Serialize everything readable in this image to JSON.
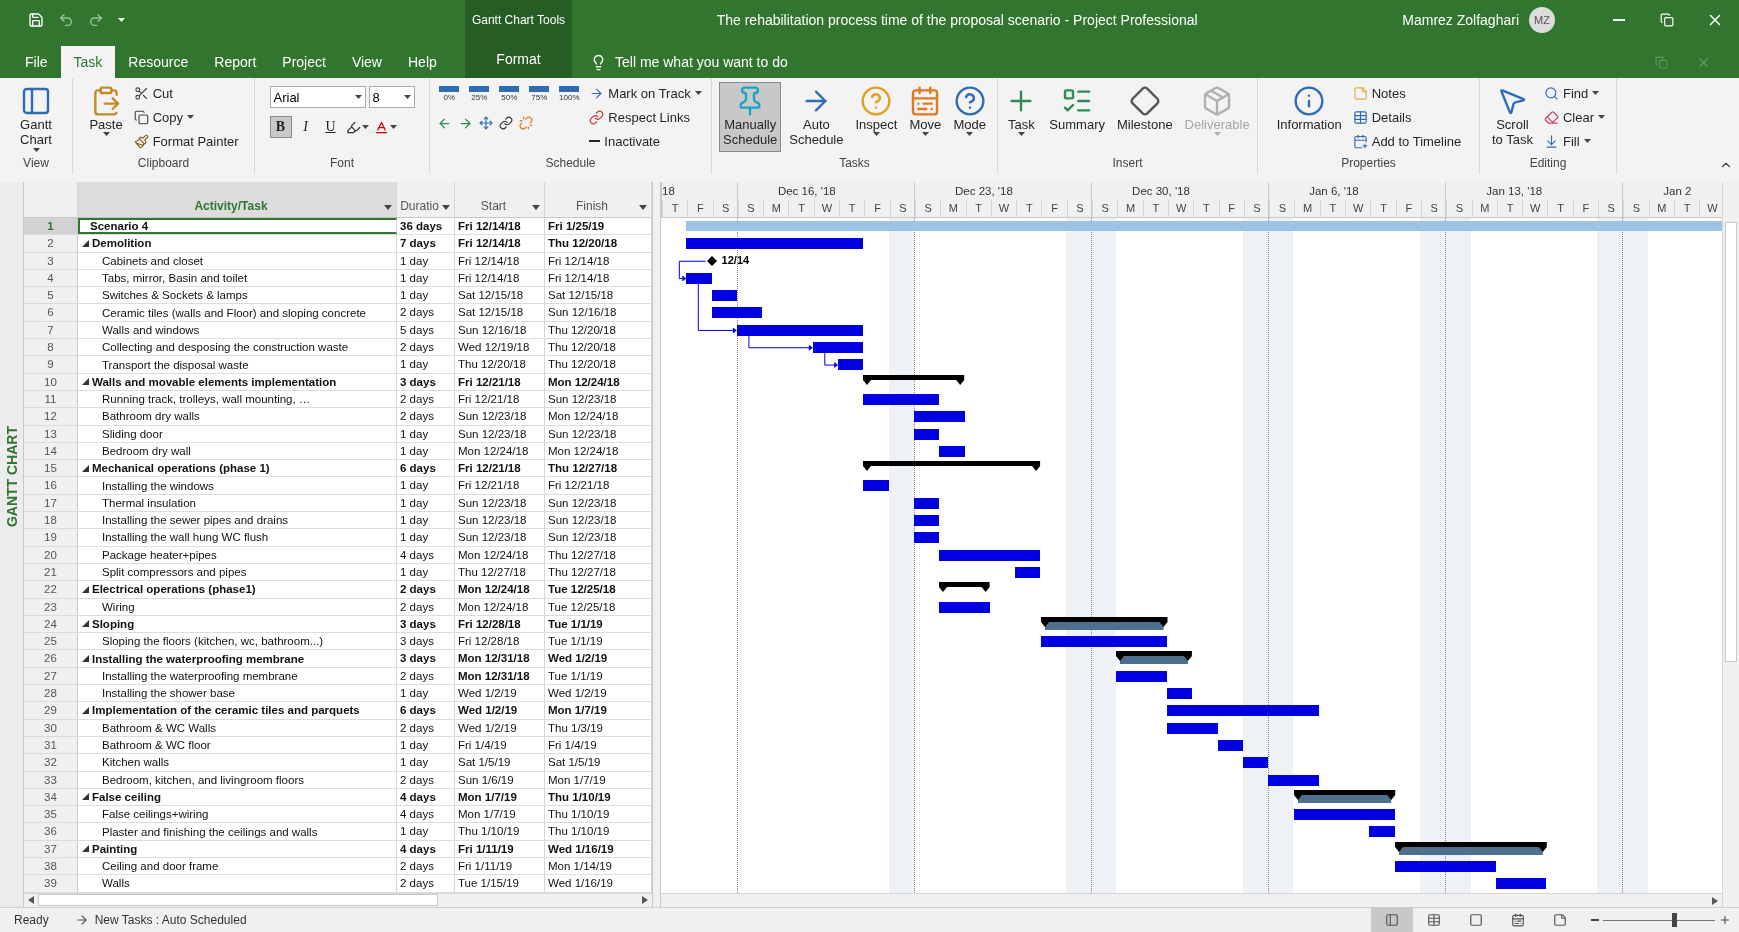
{
  "window": {
    "title": "The rehabilitation process time of the proposal scenario  -  Project Professional",
    "context_title": "Gantt Chart Tools",
    "user": "Mamrez Zolfaghari",
    "avatar": "MZ"
  },
  "tabs": [
    {
      "label": "File",
      "selected": false,
      "contextual": false
    },
    {
      "label": "Task",
      "selected": true,
      "contextual": false
    },
    {
      "label": "Resource",
      "selected": false,
      "contextual": false
    },
    {
      "label": "Report",
      "selected": false,
      "contextual": false
    },
    {
      "label": "Project",
      "selected": false,
      "contextual": false
    },
    {
      "label": "View",
      "selected": false,
      "contextual": false
    },
    {
      "label": "Help",
      "selected": false,
      "contextual": false
    },
    {
      "label": "Format",
      "selected": false,
      "contextual": true
    }
  ],
  "tell_me": {
    "placeholder": "Tell me what you want to do"
  },
  "ribbon": [
    {
      "label": "View",
      "controls": [
        {
          "kind": "large",
          "label": "Gantt\nChart",
          "dropdown": true
        }
      ]
    },
    {
      "label": "Clipboard",
      "controls": [
        {
          "kind": "large",
          "label": "Paste",
          "dropdown": true
        },
        {
          "kind": "small",
          "label": "Cut"
        },
        {
          "kind": "small",
          "label": "Copy",
          "dropdown": true
        },
        {
          "kind": "small",
          "label": "Format Painter"
        }
      ]
    },
    {
      "label": "Font",
      "controls": [
        {
          "kind": "font",
          "font": "Arial",
          "size": "8",
          "styles": [
            {
              "label": "B",
              "on": true
            },
            {
              "label": "I",
              "on": false
            },
            {
              "label": "U",
              "on": false
            }
          ]
        }
      ]
    },
    {
      "label": "Schedule",
      "controls": [
        {
          "kind": "percent",
          "items": [
            "0%",
            "25%",
            "50%",
            "75%",
            "100%"
          ]
        },
        {
          "kind": "small",
          "label": "Mark on Track",
          "dropdown": true
        },
        {
          "kind": "small",
          "label": "Respect Links"
        },
        {
          "kind": "small",
          "label": "Inactivate"
        }
      ]
    },
    {
      "label": "Tasks",
      "controls": [
        {
          "kind": "large",
          "label": "Manually\nSchedule",
          "selected": true
        },
        {
          "kind": "large",
          "label": "Auto\nSchedule",
          "selected": false
        },
        {
          "kind": "large",
          "label": "Inspect",
          "dropdown": true
        },
        {
          "kind": "large",
          "label": "Move",
          "dropdown": true
        },
        {
          "kind": "large",
          "label": "Mode",
          "dropdown": true
        }
      ]
    },
    {
      "label": "Insert",
      "controls": [
        {
          "kind": "large",
          "label": "Task",
          "dropdown": true
        },
        {
          "kind": "large",
          "label": "Summary"
        },
        {
          "kind": "large",
          "label": "Milestone"
        },
        {
          "kind": "large",
          "label": "Deliverable",
          "dropdown": true,
          "disabled": true
        }
      ]
    },
    {
      "label": "Properties",
      "controls": [
        {
          "kind": "large",
          "label": "Information"
        },
        {
          "kind": "small",
          "label": "Notes"
        },
        {
          "kind": "small",
          "label": "Details"
        },
        {
          "kind": "small",
          "label": "Add to Timeline"
        }
      ]
    },
    {
      "label": "Editing",
      "controls": [
        {
          "kind": "large",
          "label": "Scroll\nto Task"
        },
        {
          "kind": "small",
          "label": "Find",
          "dropdown": true
        },
        {
          "kind": "small",
          "label": "Clear",
          "dropdown": true
        },
        {
          "kind": "small",
          "label": "Fill",
          "dropdown": true
        }
      ]
    }
  ],
  "side_label": "GANTT CHART",
  "table": {
    "columns": [
      "Activity/Task",
      "Duratio",
      "Start",
      "Finish"
    ],
    "rows": [
      {
        "id": "1",
        "name": "Scenario 4",
        "duration": "36 days",
        "start": "Fri 12/14/18",
        "finish": "Fri 1/25/19",
        "bold": true,
        "kind": "project",
        "selected": true
      },
      {
        "id": "2",
        "name": "Demolition",
        "duration": "7 days",
        "start": "Fri 12/14/18",
        "finish": "Thu 12/20/18",
        "bold": true,
        "kind": "task",
        "selected": false,
        "expanded": true,
        "children": [
          {
            "id": "3",
            "name": "Cabinets and closet",
            "duration": "1 day",
            "start": "Fri 12/14/18",
            "finish": "Fri 12/14/18",
            "kind": "milestone",
            "milestone_label": "12/14",
            "selected": false
          },
          {
            "id": "4",
            "name": "Tabs, mirror, Basin and toilet",
            "duration": "1 day",
            "start": "Fri 12/14/18",
            "finish": "Fri 12/14/18",
            "kind": "task",
            "linked": true,
            "selected": false
          },
          {
            "id": "5",
            "name": "Switches & Sockets & lamps",
            "duration": "1 day",
            "start": "Sat 12/15/18",
            "finish": "Sat 12/15/18",
            "kind": "task",
            "selected": false
          },
          {
            "id": "6",
            "name": "Ceramic tiles (walls and Floor) and sloping concrete",
            "duration": "2 days",
            "start": "Sat 12/15/18",
            "finish": "Sun 12/16/18",
            "kind": "task",
            "selected": false
          },
          {
            "id": "7",
            "name": "Walls and windows",
            "duration": "5 days",
            "start": "Sun 12/16/18",
            "finish": "Thu 12/20/18",
            "kind": "task",
            "linked": true,
            "selected": false
          },
          {
            "id": "8",
            "name": "Collecting and desposing the construction waste",
            "duration": "2 days",
            "start": "Wed 12/19/18",
            "finish": "Thu 12/20/18",
            "kind": "task",
            "linked": true,
            "selected": false
          },
          {
            "id": "9",
            "name": "Transport the disposal waste",
            "duration": "1 day",
            "start": "Thu 12/20/18",
            "finish": "Thu 12/20/18",
            "kind": "task",
            "linked": true,
            "selected": false
          }
        ]
      },
      {
        "id": "10",
        "name": "Walls and movable elements implementation",
        "duration": "3 days",
        "start": "Fri 12/21/18",
        "finish": "Mon 12/24/18",
        "bold": true,
        "kind": "summary",
        "selected": false,
        "expanded": true,
        "children": [
          {
            "id": "11",
            "name": "Running track, trolleys, wall mounting, …",
            "duration": "2 days",
            "start": "Fri 12/21/18",
            "finish": "Sun 12/23/18",
            "kind": "task",
            "selected": false
          },
          {
            "id": "12",
            "name": "Bathroom dry walls",
            "duration": "2 days",
            "start": "Sun 12/23/18",
            "finish": "Mon 12/24/18",
            "kind": "task",
            "selected": false
          },
          {
            "id": "13",
            "name": "Sliding door",
            "duration": "1 day",
            "start": "Sun 12/23/18",
            "finish": "Sun 12/23/18",
            "kind": "task",
            "selected": false
          },
          {
            "id": "14",
            "name": "Bedroom dry wall",
            "duration": "1 day",
            "start": "Mon 12/24/18",
            "finish": "Mon 12/24/18",
            "kind": "task",
            "selected": false
          }
        ]
      },
      {
        "id": "15",
        "name": "Mechanical operations (phase 1)",
        "duration": "6 days",
        "start": "Fri 12/21/18",
        "finish": "Thu 12/27/18",
        "bold": true,
        "kind": "summary",
        "selected": false,
        "expanded": true,
        "children": [
          {
            "id": "16",
            "name": "Installing the windows",
            "duration": "1 day",
            "start": "Fri 12/21/18",
            "finish": "Fri 12/21/18",
            "kind": "task",
            "selected": false
          },
          {
            "id": "17",
            "name": "Thermal insulation",
            "duration": "1 day",
            "start": "Sun 12/23/18",
            "finish": "Sun 12/23/18",
            "kind": "task",
            "selected": false
          },
          {
            "id": "18",
            "name": "Installing the sewer pipes and drains",
            "duration": "1 day",
            "start": "Sun 12/23/18",
            "finish": "Sun 12/23/18",
            "kind": "task",
            "selected": false
          },
          {
            "id": "19",
            "name": "Installing the wall hung WC flush",
            "duration": "1 day",
            "start": "Sun 12/23/18",
            "finish": "Sun 12/23/18",
            "kind": "task",
            "selected": false
          },
          {
            "id": "20",
            "name": "Package heater+pipes",
            "duration": "4 days",
            "start": "Mon 12/24/18",
            "finish": "Thu 12/27/18",
            "kind": "task",
            "selected": false
          },
          {
            "id": "21",
            "name": "Split compressors and pipes",
            "duration": "1 day",
            "start": "Thu 12/27/18",
            "finish": "Thu 12/27/18",
            "kind": "task",
            "selected": false
          }
        ]
      },
      {
        "id": "22",
        "name": "Electrical operations (phase1)",
        "duration": "2 days",
        "start": "Mon 12/24/18",
        "finish": "Tue 12/25/18",
        "bold": true,
        "kind": "summary",
        "selected": false,
        "expanded": true,
        "children": [
          {
            "id": "23",
            "name": "Wiring",
            "duration": "2 days",
            "start": "Mon 12/24/18",
            "finish": "Tue 12/25/18",
            "kind": "task",
            "selected": false
          }
        ]
      },
      {
        "id": "24",
        "name": "Sloping",
        "duration": "3 days",
        "start": "Fri 12/28/18",
        "finish": "Tue 1/1/19",
        "bold": true,
        "kind": "rollup",
        "selected": false,
        "expanded": true,
        "children": [
          {
            "id": "25",
            "name": "Sloping the floors (kitchen, wc, bathroom...)",
            "duration": "3 days",
            "start": "Fri 12/28/18",
            "finish": "Tue 1/1/19",
            "kind": "task",
            "selected": false
          }
        ]
      },
      {
        "id": "26",
        "name": "Installing the waterproofing membrane",
        "duration": "3 days",
        "start": "Mon 12/31/18",
        "finish": "Wed 1/2/19",
        "bold": true,
        "kind": "rollup",
        "selected": false,
        "expanded": true,
        "children": [
          {
            "id": "27",
            "name": "Installing the waterproofing membrane",
            "duration": "2 days",
            "start": "**Mon 12/31/18**",
            "finish": "Tue 1/1/19",
            "kind": "task",
            "selected": false
          },
          {
            "id": "28",
            "name": "Installing the shower base",
            "duration": "1 day",
            "start": "Wed 1/2/19",
            "finish": "Wed 1/2/19",
            "kind": "task",
            "selected": false
          }
        ]
      },
      {
        "id": "29",
        "name": "Implementation of the ceramic tiles and parquets",
        "duration": "6 days",
        "start": "Wed 1/2/19",
        "finish": "Mon 1/7/19",
        "bold": true,
        "kind": "task",
        "selected": false,
        "expanded": true,
        "children": [
          {
            "id": "30",
            "name": "Bathroom & WC Walls",
            "duration": "2 days",
            "start": "Wed 1/2/19",
            "finish": "Thu 1/3/19",
            "kind": "task",
            "selected": false
          },
          {
            "id": "31",
            "name": "Bathroom & WC floor",
            "duration": "1 day",
            "start": "Fri 1/4/19",
            "finish": "Fri 1/4/19",
            "kind": "task",
            "selected": false
          },
          {
            "id": "32",
            "name": "Kitchen walls",
            "duration": "1 day",
            "start": "Sat 1/5/19",
            "finish": "Sat 1/5/19",
            "kind": "task",
            "selected": false
          },
          {
            "id": "33",
            "name": "Bedroom, kitchen, and livingroom floors",
            "duration": "2 days",
            "start": "Sun 1/6/19",
            "finish": "Mon 1/7/19",
            "kind": "task",
            "selected": false
          }
        ]
      },
      {
        "id": "34",
        "name": "False ceiling",
        "duration": "4 days",
        "start": "Mon 1/7/19",
        "finish": "Thu 1/10/19",
        "bold": true,
        "kind": "rollup",
        "selected": false,
        "expanded": true,
        "children": [
          {
            "id": "35",
            "name": "False ceilings+wiring",
            "duration": "4 days",
            "start": "Mon 1/7/19",
            "finish": "Thu 1/10/19",
            "kind": "task",
            "selected": false
          },
          {
            "id": "36",
            "name": "Plaster and finishing the ceilings and walls",
            "duration": "1 day",
            "start": "Thu 1/10/19",
            "finish": "Thu 1/10/19",
            "kind": "task",
            "selected": false
          }
        ]
      },
      {
        "id": "37",
        "name": "Painting",
        "duration": "4 days",
        "start": "Fri 1/11/19",
        "finish": "Wed 1/16/19",
        "bold": true,
        "kind": "rollup",
        "selected": false,
        "expanded": true,
        "children": [
          {
            "id": "38",
            "name": "Ceiling and door frame",
            "duration": "2 days",
            "start": "Fri 1/11/19",
            "finish": "Mon 1/14/19",
            "kind": "task",
            "selected": false
          },
          {
            "id": "39",
            "name": "Walls",
            "duration": "2 days",
            "start": "Tue 1/15/19",
            "finish": "Wed 1/16/19",
            "kind": "task",
            "selected": false
          }
        ]
      }
    ]
  },
  "timescale": [
    {
      "label": "18",
      "days": [
        {
          "letter": "T"
        },
        {
          "letter": "F"
        },
        {
          "letter": "S"
        }
      ]
    },
    {
      "label": "Dec 16, '18",
      "days": [
        {
          "letter": "S"
        },
        {
          "letter": "M"
        },
        {
          "letter": "T"
        },
        {
          "letter": "W"
        },
        {
          "letter": "T"
        },
        {
          "letter": "F"
        },
        {
          "letter": "S",
          "shaded": true
        }
      ]
    },
    {
      "label": "Dec 23, '18",
      "days": [
        {
          "letter": "S"
        },
        {
          "letter": "M"
        },
        {
          "letter": "T"
        },
        {
          "letter": "W"
        },
        {
          "letter": "T"
        },
        {
          "letter": "F"
        },
        {
          "letter": "S",
          "shaded": true
        }
      ]
    },
    {
      "label": "Dec 30, '18",
      "days": [
        {
          "letter": "S",
          "shaded": true
        },
        {
          "letter": "M"
        },
        {
          "letter": "T"
        },
        {
          "letter": "W"
        },
        {
          "letter": "T"
        },
        {
          "letter": "F"
        },
        {
          "letter": "S",
          "shaded": true
        }
      ]
    },
    {
      "label": "Jan 6, '18",
      "days": [
        {
          "letter": "S",
          "shaded": true
        },
        {
          "letter": "M"
        },
        {
          "letter": "T"
        },
        {
          "letter": "W"
        },
        {
          "letter": "T"
        },
        {
          "letter": "F"
        },
        {
          "letter": "S",
          "shaded": true
        }
      ]
    },
    {
      "label": "Jan 13, '18",
      "days": [
        {
          "letter": "S",
          "shaded": true
        },
        {
          "letter": "M"
        },
        {
          "letter": "T"
        },
        {
          "letter": "W"
        },
        {
          "letter": "T"
        },
        {
          "letter": "F"
        },
        {
          "letter": "S",
          "shaded": true
        }
      ]
    },
    {
      "label": "Jan 2",
      "days": [
        {
          "letter": "S",
          "shaded": true
        },
        {
          "letter": "M"
        },
        {
          "letter": "T"
        },
        {
          "letter": "W"
        }
      ]
    }
  ],
  "status_bar": {
    "ready": "Ready",
    "new_tasks": "New Tasks : Auto Scheduled",
    "views": [
      {
        "selected": true
      },
      {
        "selected": false
      },
      {
        "selected": false
      },
      {
        "selected": false
      },
      {
        "selected": false
      }
    ],
    "zoom": {
      "level": 0.63
    }
  }
}
